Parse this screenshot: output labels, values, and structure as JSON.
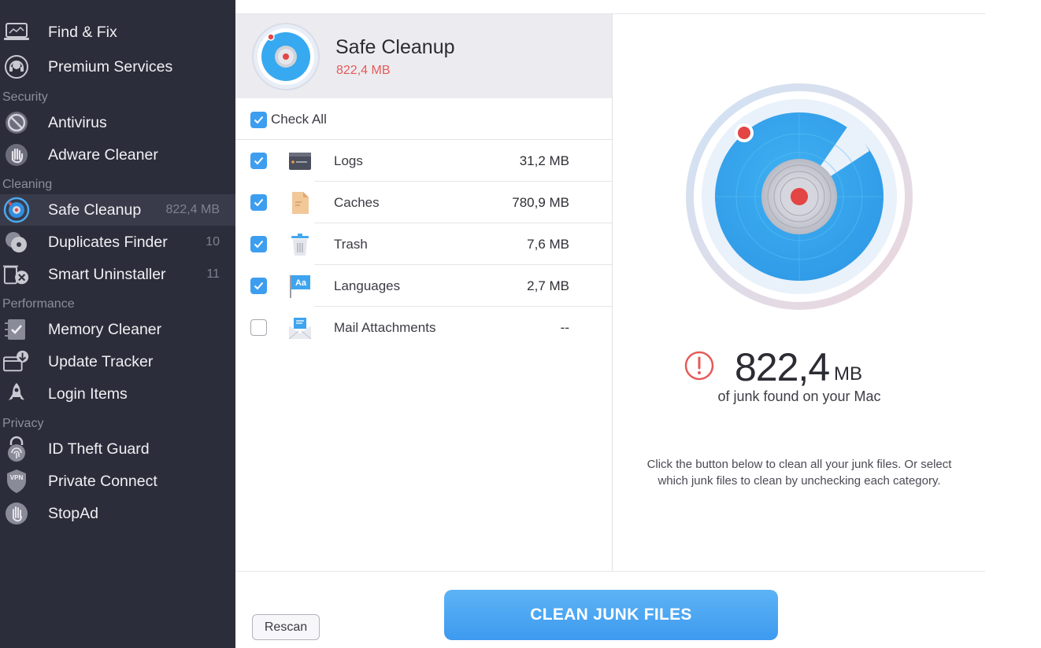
{
  "sidebar": {
    "items": [
      {
        "label": "Find & Fix",
        "icon": "laptop-icon"
      },
      {
        "label": "Premium Services",
        "icon": "headset-icon"
      },
      {
        "label": "Antivirus",
        "icon": "antivirus-icon"
      },
      {
        "label": "Adware Cleaner",
        "icon": "hand-icon"
      },
      {
        "label": "Safe Cleanup",
        "icon": "radar-icon",
        "badge": "822,4 MB",
        "active": true
      },
      {
        "label": "Duplicates Finder",
        "icon": "duplicates-icon",
        "badge": "10"
      },
      {
        "label": "Smart Uninstaller",
        "icon": "uninstaller-icon",
        "badge": "11"
      },
      {
        "label": "Memory Cleaner",
        "icon": "memory-check-icon"
      },
      {
        "label": "Update Tracker",
        "icon": "update-download-icon"
      },
      {
        "label": "Login Items",
        "icon": "rocket-icon"
      },
      {
        "label": "ID Theft Guard",
        "icon": "fingerprint-lock-icon"
      },
      {
        "label": "Private Connect",
        "icon": "vpn-shield-icon"
      },
      {
        "label": "StopAd",
        "icon": "stop-hand-icon"
      }
    ],
    "sections": [
      "Security",
      "Cleaning",
      "Performance",
      "Privacy"
    ]
  },
  "header": {
    "title": "Safe Cleanup",
    "size": "822,4 MB"
  },
  "check_all": {
    "label": "Check All",
    "checked": true
  },
  "categories": [
    {
      "name": "Logs",
      "size": "31,2 MB",
      "checked": true,
      "icon": "logs-icon"
    },
    {
      "name": "Caches",
      "size": "780,9 MB",
      "checked": true,
      "icon": "caches-icon"
    },
    {
      "name": "Trash",
      "size": "7,6 MB",
      "checked": true,
      "icon": "trash-icon"
    },
    {
      "name": "Languages",
      "size": "2,7 MB",
      "checked": true,
      "icon": "languages-icon"
    },
    {
      "name": "Mail Attachments",
      "size": "--",
      "checked": false,
      "icon": "mail-attachments-icon"
    }
  ],
  "summary": {
    "amount": "822,4",
    "unit": "MB",
    "caption": "of junk found on your Mac",
    "instructions": "Click the button below to clean all your junk files. Or select which junk files to clean by unchecking each category."
  },
  "buttons": {
    "rescan": "Rescan",
    "clean": "CLEAN JUNK FILES"
  },
  "colors": {
    "sidebar_bg": "#2c2d3a",
    "accent": "#3d9ef0",
    "alert": "#e55a5a"
  }
}
